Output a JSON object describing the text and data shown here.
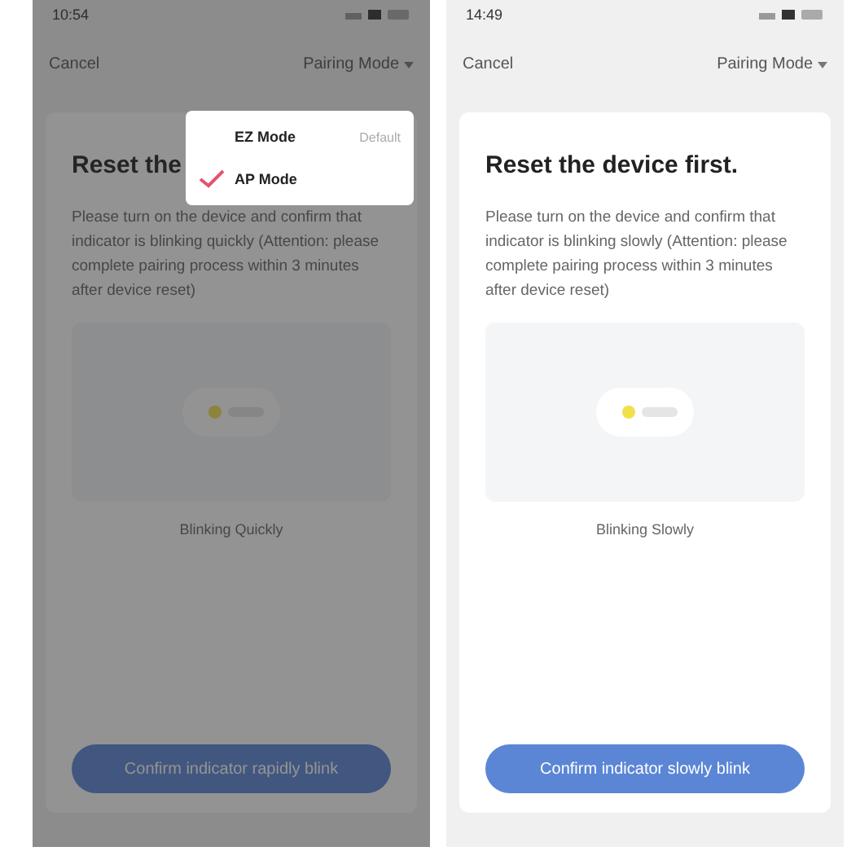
{
  "screens": [
    {
      "status_time": "10:54",
      "cancel": "Cancel",
      "mode_selector": "Pairing Mode",
      "dimmed": true,
      "title": "Reset the",
      "description": "Please turn on the device and confirm that indicator is blinking quickly (Attention: please complete pairing process within 3 minutes after device reset)",
      "caption": "Blinking Quickly",
      "confirm": "Confirm indicator rapidly blink",
      "menu": [
        {
          "label": "EZ Mode",
          "tag": "Default",
          "selected": false
        },
        {
          "label": "AP Mode",
          "selected": true
        }
      ]
    },
    {
      "status_time": "14:49",
      "cancel": "Cancel",
      "mode_selector": "Pairing Mode",
      "dimmed": false,
      "title": "Reset the device first.",
      "description": "Please turn on the device and confirm that indicator is blinking slowly (Attention: please complete pairing process within 3 minutes after device reset)",
      "caption": "Blinking Slowly",
      "confirm": "Confirm indicator slowly blink"
    }
  ]
}
